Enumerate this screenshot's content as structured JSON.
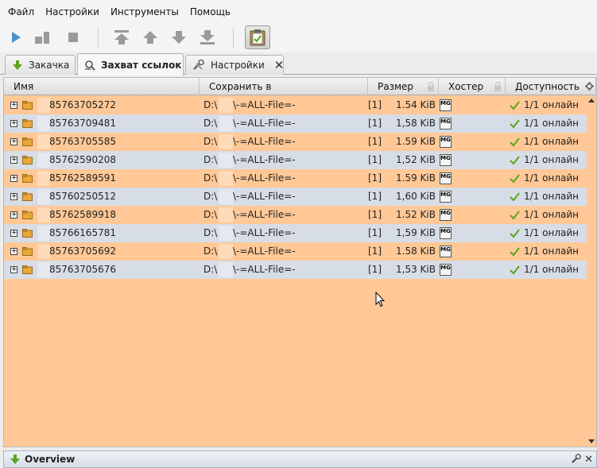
{
  "menu": [
    "Файл",
    "Настройки",
    "Инструменты",
    "Помощь"
  ],
  "tabs": [
    {
      "label": "Закачка",
      "active": false
    },
    {
      "label": "Захват ссылок",
      "active": true
    },
    {
      "label": "Настройки",
      "active": false,
      "closable": true
    }
  ],
  "columns": [
    "Имя",
    "Сохранить в",
    "Размер",
    "Хостер",
    "Доступность"
  ],
  "rows": [
    {
      "name": "85763705272",
      "path": "D:\\",
      "folder": "\\-=ALL-File=-",
      "count": "[1]",
      "size": "1.54 KiB",
      "hoster": "MG",
      "availability": "1/1 онлайн"
    },
    {
      "name": "85763709481",
      "path": "D:\\",
      "folder": "\\-=ALL-File=-",
      "count": "[1]",
      "size": "1,58 KiB",
      "hoster": "MG",
      "availability": "1/1 онлайн"
    },
    {
      "name": "85763705585",
      "path": "D:\\",
      "folder": "\\-=ALL-File=-",
      "count": "[1]",
      "size": "1.59 KiB",
      "hoster": "MG",
      "availability": "1/1 онлайн"
    },
    {
      "name": "85762590208",
      "path": "D:\\",
      "folder": "\\-=ALL-File=-",
      "count": "[1]",
      "size": "1,52 KiB",
      "hoster": "MG",
      "availability": "1/1 онлайн"
    },
    {
      "name": "85762589591",
      "path": "D:\\",
      "folder": "\\-=ALL-File=-",
      "count": "[1]",
      "size": "1.59 KiB",
      "hoster": "MG",
      "availability": "1/1 онлайн"
    },
    {
      "name": "85760250512",
      "path": "D:\\",
      "folder": "\\-=ALL-File=-",
      "count": "[1]",
      "size": "1,60 KiB",
      "hoster": "MG",
      "availability": "1/1 онлайн"
    },
    {
      "name": "85762589918",
      "path": "D:\\",
      "folder": "\\-=ALL-File=-",
      "count": "[1]",
      "size": "1.52 KiB",
      "hoster": "MG",
      "availability": "1/1 онлайн"
    },
    {
      "name": "85766165781",
      "path": "D:\\",
      "folder": "\\-=ALL-File=-",
      "count": "[1]",
      "size": "1,59 KiB",
      "hoster": "MG",
      "availability": "1/1 онлайн"
    },
    {
      "name": "85763705692",
      "path": "D:\\",
      "folder": "\\-=ALL-File=-",
      "count": "[1]",
      "size": "1.58 KiB",
      "hoster": "MG",
      "availability": "1/1 онлайн"
    },
    {
      "name": "85763705676",
      "path": "D:\\",
      "folder": "\\-=ALL-File=-",
      "count": "[1]",
      "size": "1,53 KiB",
      "hoster": "MG",
      "availability": "1/1 онлайн"
    }
  ],
  "overview": {
    "title": "Overview"
  },
  "colors": {
    "row_odd": "#ffc896",
    "row_even": "#d7dde6",
    "accent_green": "#5aa51e",
    "icon_gray": "#9a9a9a",
    "toolbar_blue": "#4a90c8"
  },
  "icons": {
    "toolbar": [
      "play-icon",
      "pause-icon",
      "stop-icon",
      "move-top-icon",
      "move-up-icon",
      "move-down-icon",
      "move-bottom-icon",
      "clipboard-icon"
    ],
    "tabs": [
      "download-arrow-icon",
      "link-grabber-icon",
      "wrench-icon"
    ]
  }
}
